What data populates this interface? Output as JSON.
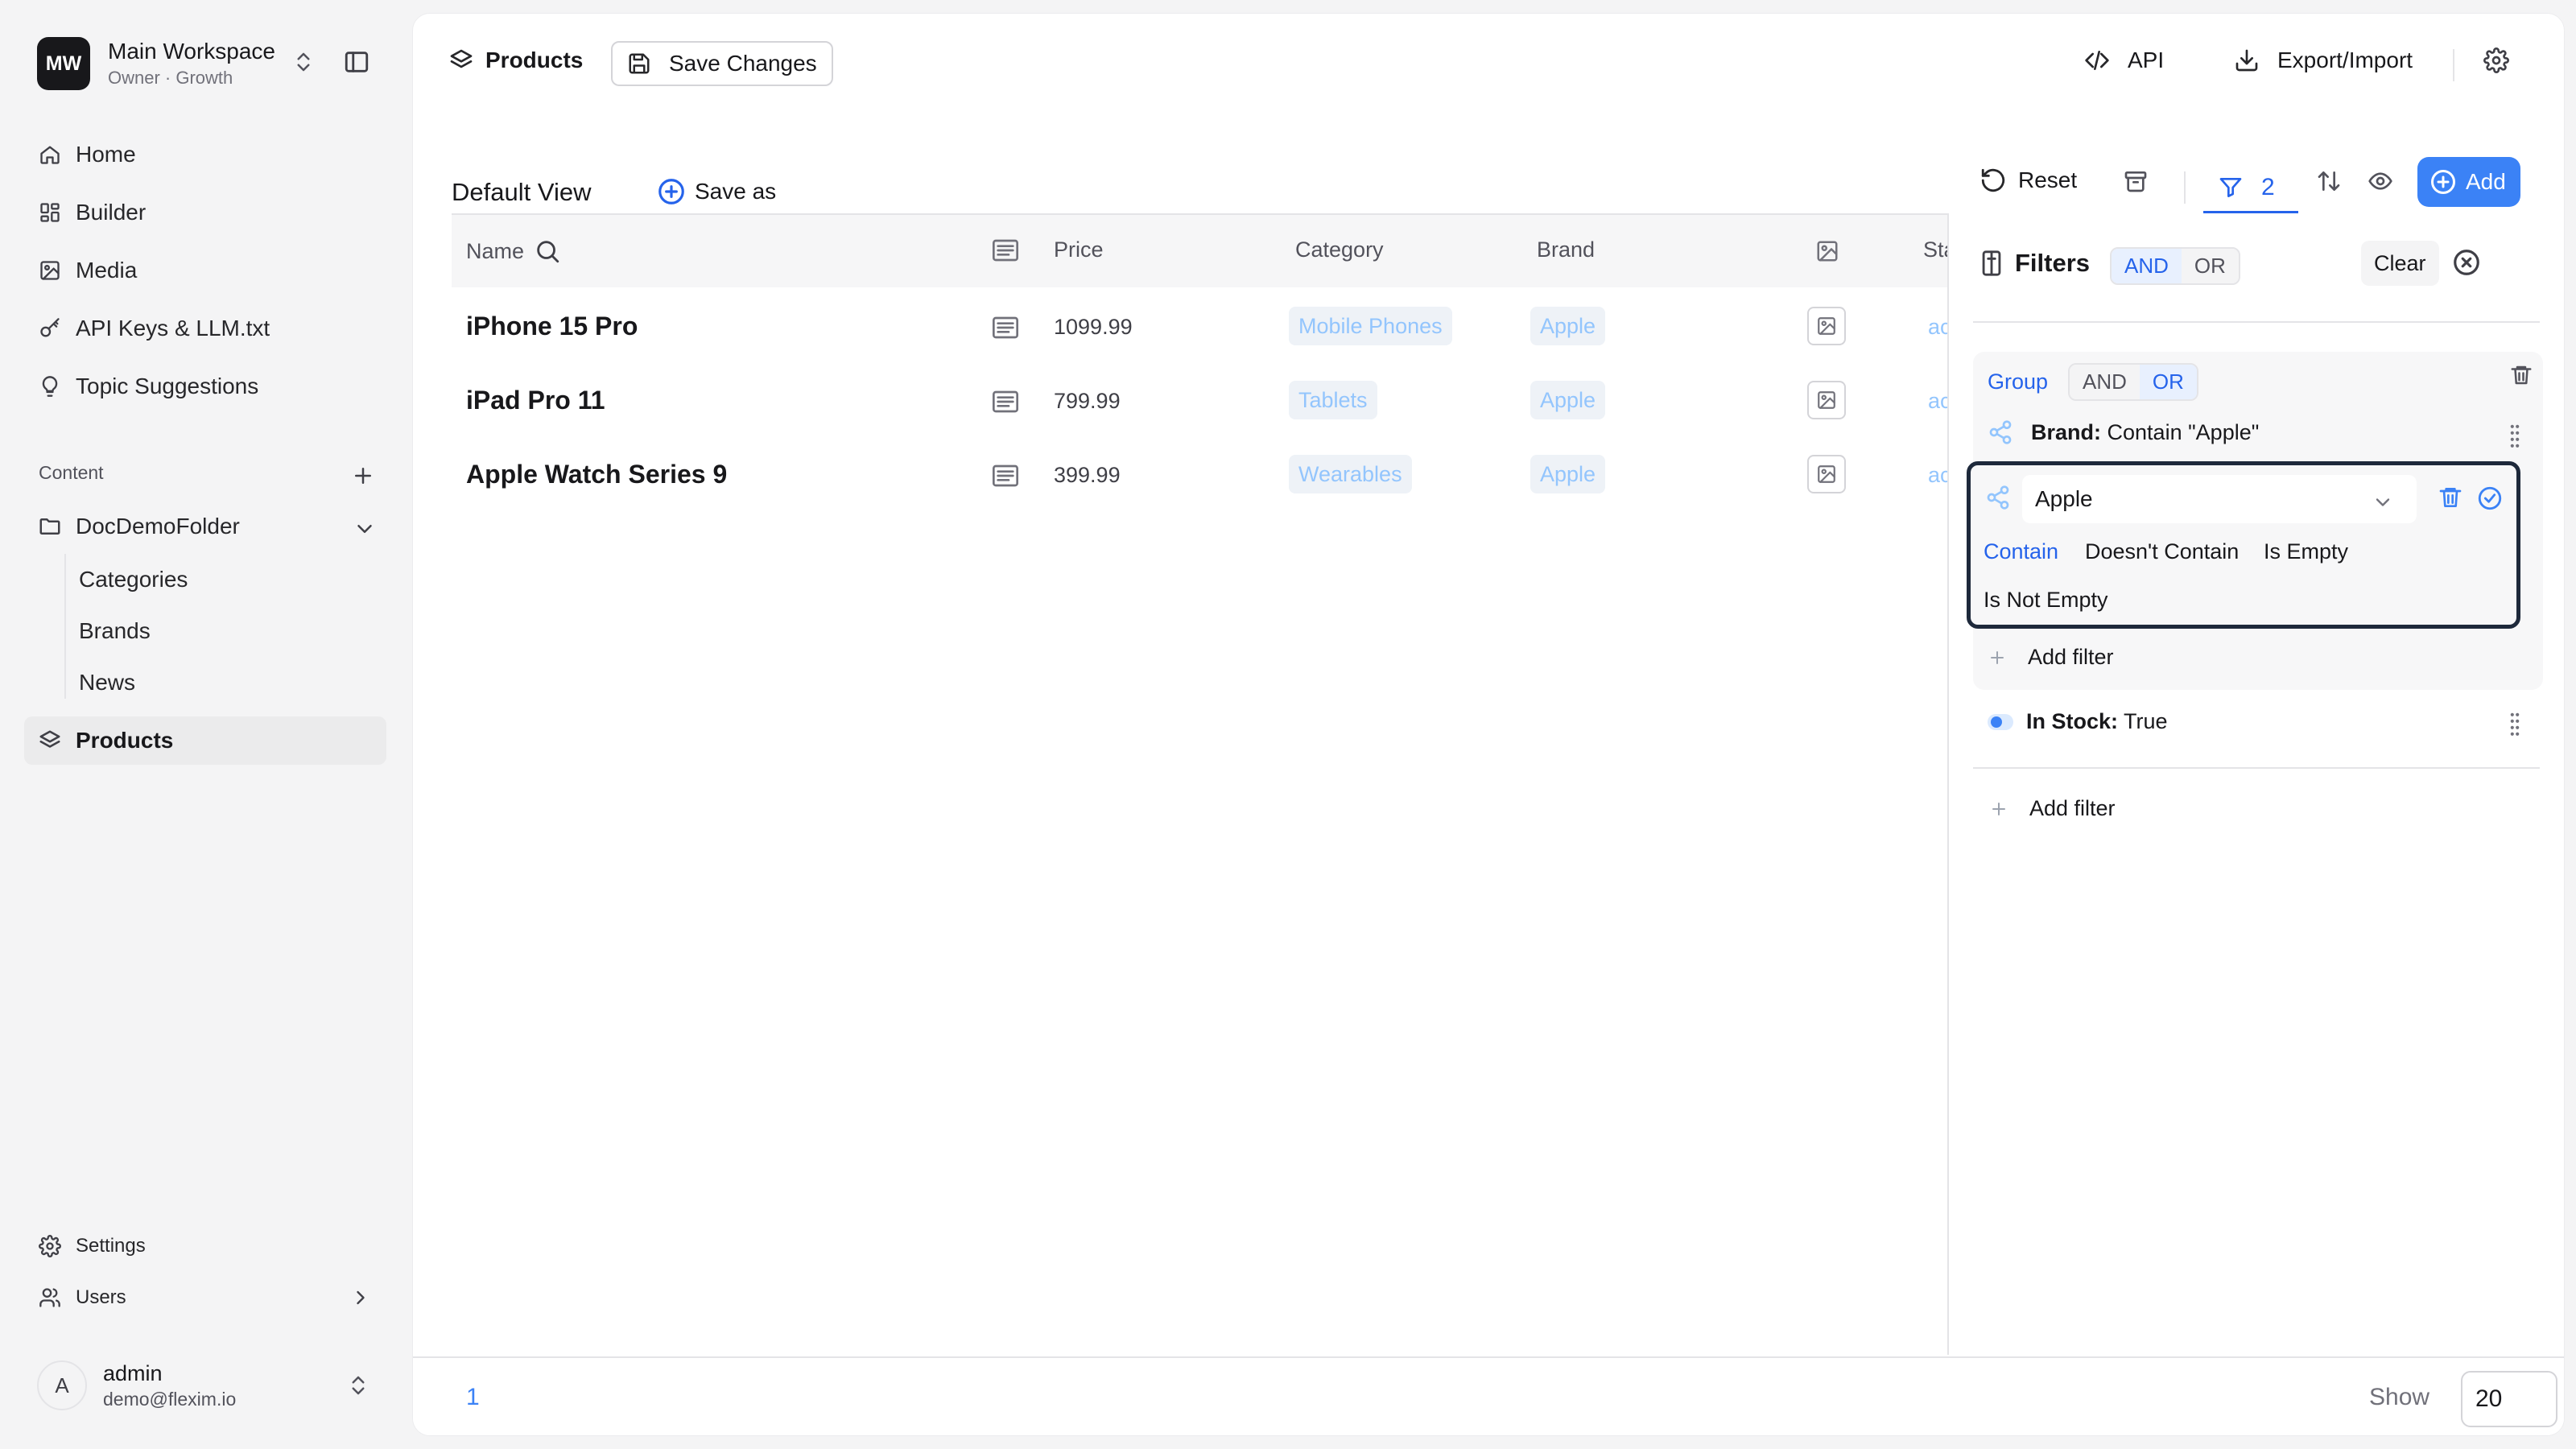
{
  "workspace": {
    "initials": "MW",
    "name": "Main Workspace",
    "subtitle": "Owner · Growth"
  },
  "nav": {
    "home": "Home",
    "builder": "Builder",
    "media": "Media",
    "api_keys": "API Keys & LLM.txt",
    "topics": "Topic Suggestions"
  },
  "content_section": {
    "label": "Content",
    "folder": "DocDemoFolder",
    "children": [
      "Categories",
      "Brands",
      "News"
    ],
    "products": "Products"
  },
  "bottom_nav": {
    "settings": "Settings",
    "users": "Users"
  },
  "user": {
    "initial": "A",
    "name": "admin",
    "email": "demo@flexim.io"
  },
  "topbar": {
    "title": "Products",
    "save_changes": "Save Changes",
    "api": "API",
    "export_import": "Export/Import"
  },
  "views": {
    "default": "Default View",
    "save_as": "Save as"
  },
  "toolbar": {
    "reset": "Reset",
    "filter_count": "2",
    "add": "Add"
  },
  "table": {
    "headers": {
      "name": "Name",
      "price": "Price",
      "category": "Category",
      "brand": "Brand",
      "status": "Status"
    },
    "rows": [
      {
        "name": "iPhone 15 Pro",
        "price": "1099.99",
        "category": "Mobile Phones",
        "brand": "Apple",
        "status": "active"
      },
      {
        "name": "iPad Pro 11",
        "price": "799.99",
        "category": "Tablets",
        "brand": "Apple",
        "status": "active"
      },
      {
        "name": "Apple Watch Series 9",
        "price": "399.99",
        "category": "Wearables",
        "brand": "Apple",
        "status": "active"
      }
    ]
  },
  "filters": {
    "title": "Filters",
    "logic": {
      "and": "AND",
      "or": "OR",
      "selected": "AND"
    },
    "clear": "Clear",
    "group": {
      "label": "Group",
      "logic": {
        "and": "AND",
        "or": "OR",
        "selected": "OR"
      },
      "rule_field": "Brand:",
      "rule_value": "Contain \"Apple\"",
      "edit_value": "Apple",
      "operators": [
        "Contain",
        "Doesn't Contain",
        "Is Empty",
        "Is Not Empty"
      ],
      "selected_operator": "Contain",
      "add_filter": "Add filter"
    },
    "stock_rule": {
      "field": "In Stock:",
      "value": "True"
    },
    "add_filter": "Add filter"
  },
  "pagination": {
    "page": "1",
    "show_label": "Show",
    "page_size": "20"
  },
  "colors": {
    "accent": "#3b82f6",
    "chip_text": "#93c5fd",
    "chip_bg": "#eef2f7",
    "sidebar_bg": "#f4f4f5"
  }
}
